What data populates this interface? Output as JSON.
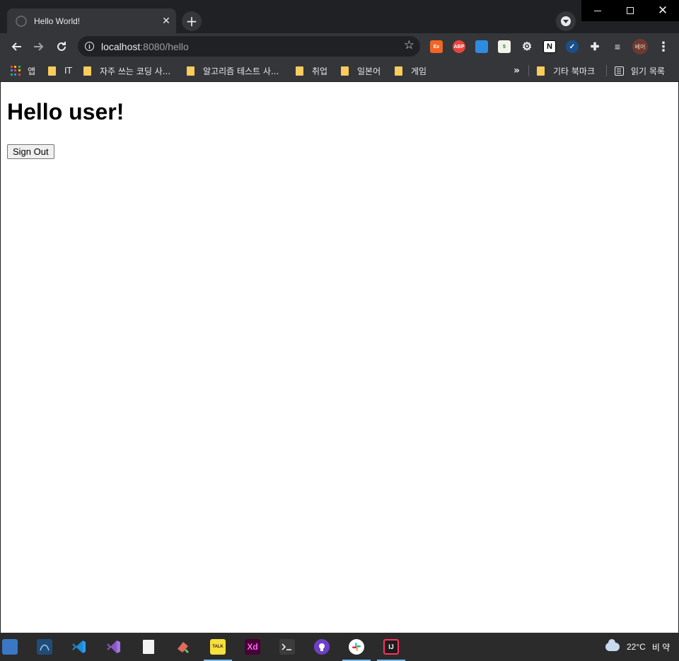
{
  "browser": {
    "tab": {
      "title": "Hello World!",
      "close_glyph": "✕"
    },
    "new_tab_glyph": "+",
    "address": {
      "host": "localhost",
      "rest": ":8080/hello"
    },
    "profile_label": "베어",
    "window_controls": {
      "close_glyph": "✕"
    }
  },
  "bookmarks": {
    "items": [
      {
        "label": "앱"
      },
      {
        "label": "IT"
      },
      {
        "label": "자주 쓰는 코딩 사..."
      },
      {
        "label": "알고리즘 테스트 사..."
      },
      {
        "label": "취업"
      },
      {
        "label": "일본어"
      },
      {
        "label": "게임"
      }
    ],
    "more_glyph": "»",
    "other_bookmarks": "기타 북마크",
    "reading_list": "읽기 목록"
  },
  "extensions": [
    {
      "name": "ex-extension-icon",
      "label": "Ex"
    },
    {
      "name": "adblock-plus-icon",
      "label": "ABP"
    },
    {
      "name": "window-extension-icon",
      "label": ""
    },
    {
      "name": "notes-extension-icon",
      "label": "5"
    },
    {
      "name": "gear-extension-icon",
      "label": "⚙"
    },
    {
      "name": "notion-icon",
      "label": "N"
    },
    {
      "name": "check-extension-icon",
      "label": "✓"
    },
    {
      "name": "puzzle-icon",
      "label": "✚"
    },
    {
      "name": "media-queue-icon",
      "label": "≡"
    }
  ],
  "page": {
    "heading": "Hello user!",
    "signout_label": "Sign Out"
  },
  "taskbar": {
    "apps": [
      {
        "name": "taskbar-app-1",
        "color": "#3a78c6",
        "label": ""
      },
      {
        "name": "taskbar-mysql-workbench",
        "color": "#1f4d78",
        "label": ""
      },
      {
        "name": "taskbar-vscode",
        "color": "#1f8ad8",
        "label": ""
      },
      {
        "name": "taskbar-visual-studio",
        "color": "#8a57c9",
        "label": ""
      },
      {
        "name": "taskbar-notepad",
        "color": "#f3f3f3",
        "label": ""
      },
      {
        "name": "taskbar-paint",
        "color": "#e06b5d",
        "label": ""
      },
      {
        "name": "taskbar-kakaotalk",
        "color": "#f7e03a",
        "label": "TALK"
      },
      {
        "name": "taskbar-adobe-xd",
        "color": "#470137",
        "label": "Xd"
      },
      {
        "name": "taskbar-terminal",
        "color": "#3c3c3c",
        "label": ""
      },
      {
        "name": "taskbar-github-desktop",
        "color": "#6e40c9",
        "label": ""
      },
      {
        "name": "taskbar-slack",
        "color": "#ffffff",
        "label": ""
      },
      {
        "name": "taskbar-intellij",
        "color": "#1c1c1c",
        "label": "IJ"
      }
    ],
    "weather": {
      "temp": "22°C",
      "desc": "비 약"
    }
  }
}
